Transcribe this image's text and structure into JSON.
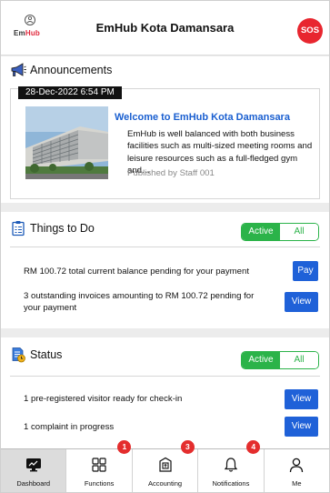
{
  "header": {
    "logo_em": "Em",
    "logo_hub": "Hub",
    "title": "EmHub Kota Damansara",
    "sos_label": "SOS"
  },
  "announcements": {
    "title": "Announcements",
    "date": "28-Dec-2022 6:54 PM",
    "post_title": "Welcome to EmHub Kota Damansara",
    "post_body": "EmHub is well balanced with both business facilities such as multi-sized meeting rooms and leisure resources such as a full-fledged gym and…",
    "post_author": "Published by Staff 001"
  },
  "todo": {
    "title": "Things to Do",
    "toggle_active": "Active",
    "toggle_all": "All",
    "rows": [
      {
        "text": "RM 100.72 total current balance pending for your payment",
        "action": "Pay"
      },
      {
        "text": "3 outstanding invoices amounting to RM 100.72 pending for your payment",
        "action": "View"
      }
    ]
  },
  "status": {
    "title": "Status",
    "toggle_active": "Active",
    "toggle_all": "All",
    "rows": [
      {
        "text": "1 pre-registered visitor ready for check-in",
        "action": "View"
      },
      {
        "text": "1 complaint in progress",
        "action": "View"
      }
    ]
  },
  "nav": {
    "items": [
      {
        "label": "Dashboard",
        "icon": "dashboard-icon",
        "badge": ""
      },
      {
        "label": "Functions",
        "icon": "grid-icon",
        "badge": "1"
      },
      {
        "label": "Accounting",
        "icon": "invoice-icon",
        "badge": "3"
      },
      {
        "label": "Notifications",
        "icon": "bell-icon",
        "badge": "4"
      },
      {
        "label": "Me",
        "icon": "user-icon",
        "badge": ""
      }
    ]
  },
  "colors": {
    "accent_blue": "#1f61d8",
    "toggle_green": "#2bb349",
    "sos_red": "#e8262f",
    "badge_red": "#e42d2d"
  }
}
